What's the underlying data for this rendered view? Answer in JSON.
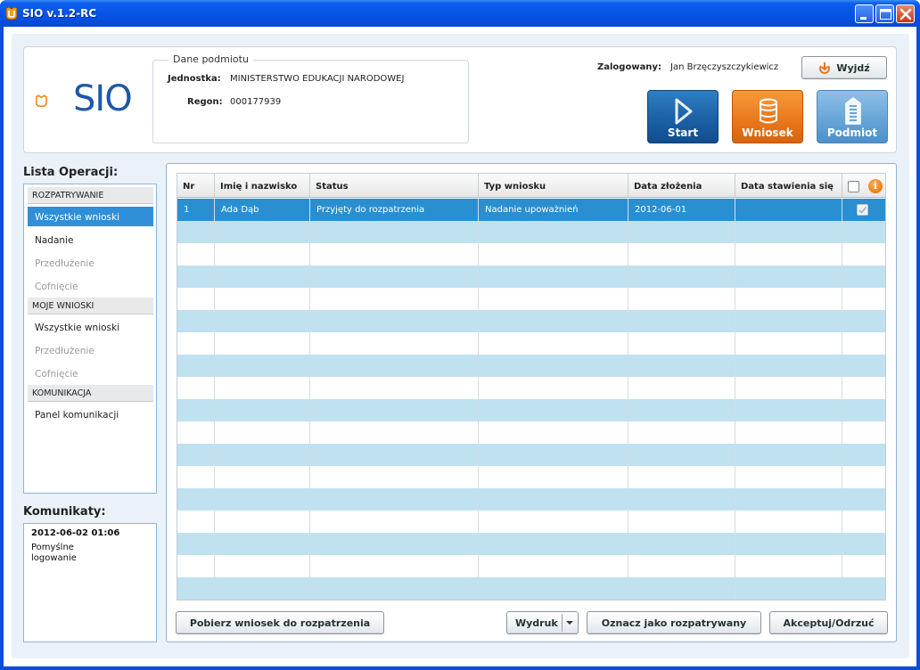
{
  "window": {
    "title": "SIO v.1.2-RC"
  },
  "header": {
    "logo_text": "SIO",
    "fieldset_legend": "Dane podmiotu",
    "jednostka_label": "Jednostka:",
    "jednostka_value": "MINISTERSTWO EDUKACJI NARODOWEJ",
    "regon_label": "Regon:",
    "regon_value": "000177939",
    "logged_label": "Zalogowany:",
    "logged_user": "Jan Brzęczyszczykiewicz",
    "logout_label": "Wyjdź",
    "nav": [
      {
        "label": "Start",
        "icon": "play-icon"
      },
      {
        "label": "Wniosek",
        "icon": "database-icon"
      },
      {
        "label": "Podmiot",
        "icon": "building-icon"
      }
    ]
  },
  "sidebar": {
    "title": "Lista Operacji:",
    "sections": [
      {
        "header": "ROZPATRYWANIE",
        "items": [
          {
            "label": "Wszystkie wnioski",
            "state": "selected"
          },
          {
            "label": "Nadanie",
            "state": "enabled"
          },
          {
            "label": "Przedłużenie",
            "state": "disabled"
          },
          {
            "label": "Cofnięcie",
            "state": "disabled"
          }
        ]
      },
      {
        "header": "MOJE WNIOSKI",
        "items": [
          {
            "label": "Wszystkie wnioski",
            "state": "enabled"
          },
          {
            "label": "Przedłużenie",
            "state": "disabled"
          },
          {
            "label": "Cofnięcie",
            "state": "disabled"
          }
        ]
      },
      {
        "header": "KOMUNIKACJA",
        "items": [
          {
            "label": "Panel komunikacji",
            "state": "enabled"
          }
        ]
      }
    ]
  },
  "messages": {
    "title": "Komunikaty:",
    "timestamp": "2012-06-02 01:06",
    "text_line1": "Pomyślne",
    "text_line2": "logowanie"
  },
  "table": {
    "columns": [
      "Nr",
      "Imię i nazwisko",
      "Status",
      "Typ wniosku",
      "Data złożenia",
      "Data stawienia się"
    ],
    "rows": [
      {
        "nr": "1",
        "name": "Ada Dąb",
        "status": "Przyjęty do rozpatrzenia",
        "type": "Nadanie upoważnień",
        "date_filed": "2012-06-01",
        "date_appear": "",
        "checked": true,
        "selected": true
      }
    ],
    "empty_rows": 17,
    "colors": {
      "selected": "#2a8fd0",
      "alt": "#bfe1f0",
      "plain": "#ffffff"
    }
  },
  "actions": {
    "fetch": "Pobierz wniosek do rozpatrzenia",
    "print": "Wydruk",
    "mark": "Oznacz jako rozpatrywany",
    "accept": "Akceptuj/Odrzuć"
  }
}
